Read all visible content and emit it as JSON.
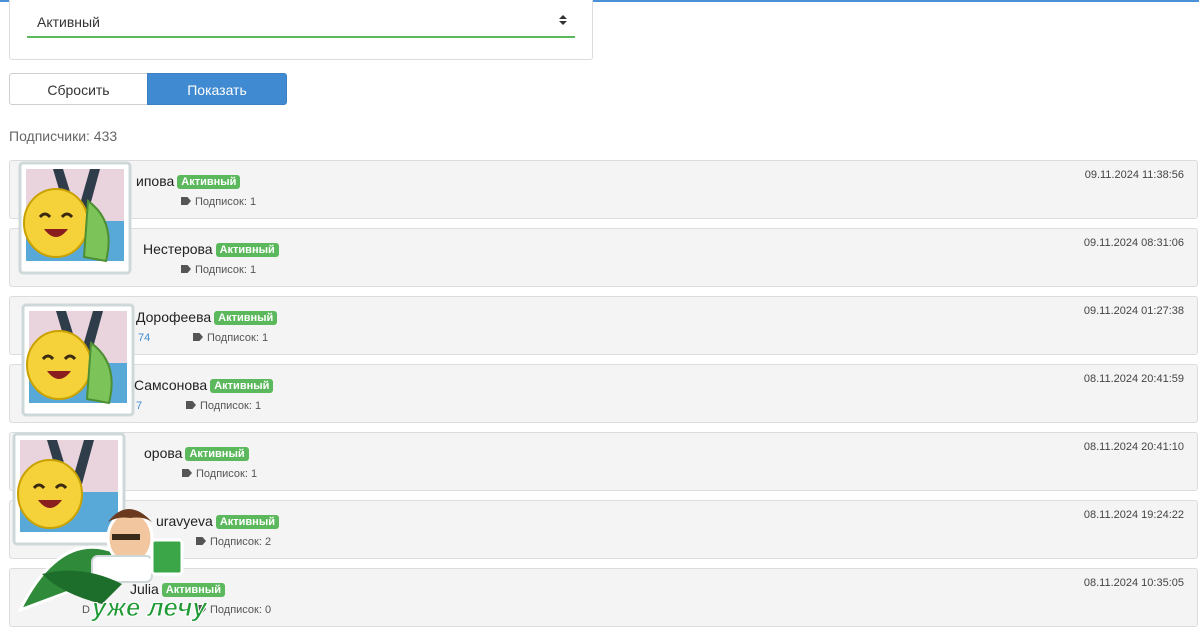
{
  "filter": {
    "status_value": "Активный"
  },
  "buttons": {
    "reset": "Сбросить",
    "show": "Показать"
  },
  "summary": {
    "subscribers": "Подписчики: 433"
  },
  "rows": [
    {
      "name": "ипова",
      "status": "Активный",
      "phone": "",
      "subs": "Подписок: 1",
      "date": "09.11.2024 11:38:56"
    },
    {
      "name": "Нестерова",
      "status": "Активный",
      "phone": "",
      "subs": "Подписок: 1",
      "date": "09.11.2024 08:31:06"
    },
    {
      "name": "Дорофеева",
      "status": "Активный",
      "phone": "74",
      "subs": "Подписок: 1",
      "date": "09.11.2024 01:27:38"
    },
    {
      "name": "Самсонова",
      "status": "Активный",
      "phone": "7",
      "subs": "Подписок: 1",
      "date": "08.11.2024 20:41:59"
    },
    {
      "name": "орова",
      "status": "Активный",
      "phone": "",
      "subs": "Подписок: 1",
      "date": "08.11.2024 20:41:10"
    },
    {
      "name": "uravyeva",
      "status": "Активный",
      "phone": "",
      "subs": "Подписок: 2",
      "date": "08.11.2024 19:24:22"
    },
    {
      "name": "Julia",
      "status": "Активный",
      "phone": "D",
      "subs": "Подписок: 0",
      "date": "08.11.2024 10:35:05"
    }
  ],
  "stickers": {
    "caption": "уже лечу"
  },
  "colors": {
    "accent": "#3f8ad0",
    "badge": "#5cb85c",
    "row_bg": "#f4f4f4"
  }
}
